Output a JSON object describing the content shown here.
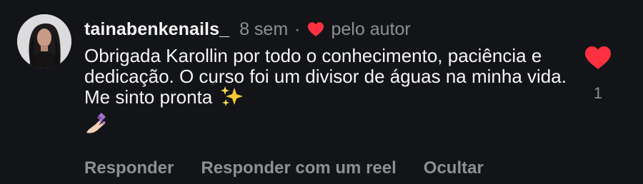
{
  "comment": {
    "username": "tainabenkenails_",
    "time_ago": "8 sem",
    "separator": "·",
    "author_badge_label": "pelo autor",
    "text": "Obrigada Karollin por todo o conhecimento, paciência e dedicação. O curso foi um divisor de águas na minha vida. Me sinto pronta",
    "emojis": [
      "sparkles-emoji",
      "nail-polish-emoji"
    ],
    "like_count": "1",
    "liked": true
  },
  "actions": {
    "reply_label": "Responder",
    "reply_with_reel_label": "Responder com um reel",
    "hide_label": "Ocultar"
  },
  "colors": {
    "background": "#131417",
    "text_primary": "#f5f5f5",
    "text_secondary": "#8e8f94",
    "heart_red": "#ff3040"
  },
  "icons": {
    "author_heart": "heart-icon",
    "like": "heart-filled-icon"
  }
}
